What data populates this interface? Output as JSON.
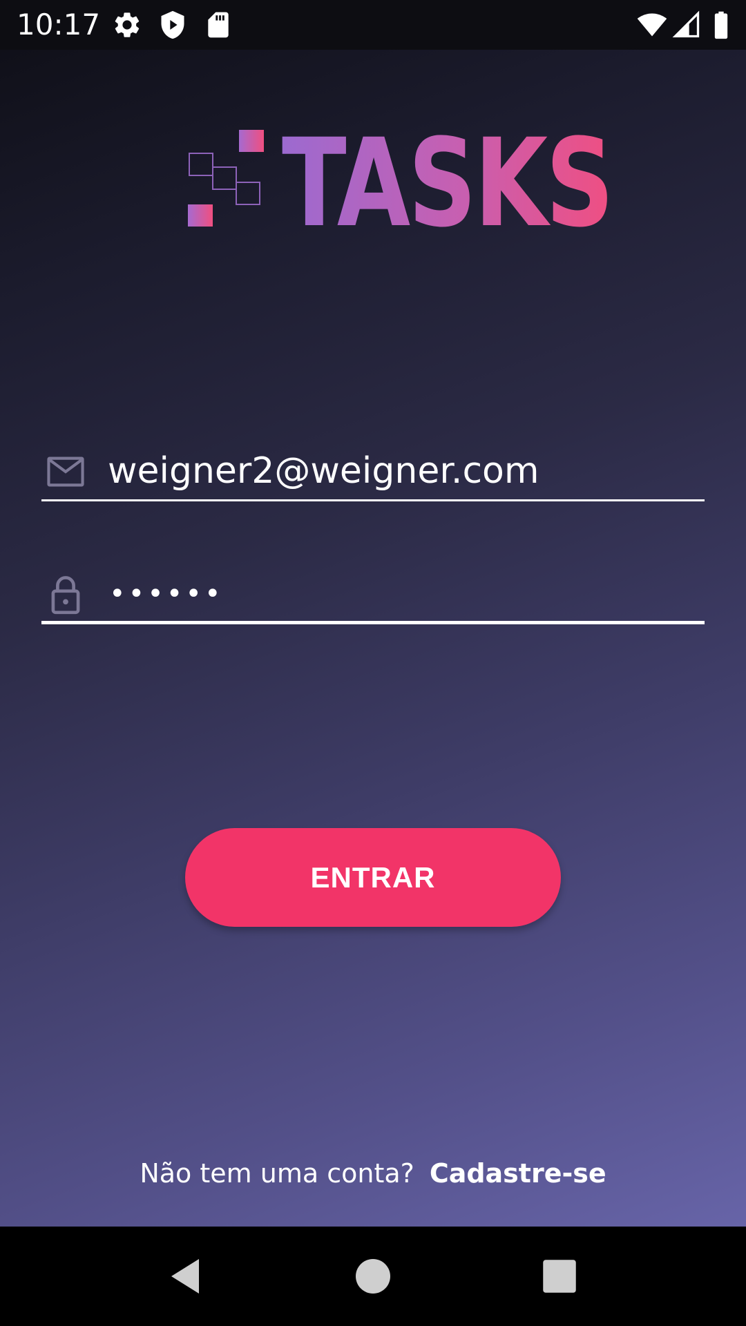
{
  "status_bar": {
    "time": "10:17",
    "icons": [
      "settings-icon",
      "shield-icon",
      "sd-card-icon",
      "wifi-icon",
      "signal-icon",
      "battery-icon"
    ]
  },
  "logo": {
    "text": "TASKS"
  },
  "login_form": {
    "email": {
      "icon": "mail-icon",
      "value": "weigner2@weigner.com"
    },
    "password": {
      "icon": "lock-icon",
      "masked_value": "••••••"
    },
    "submit_label": "ENTRAR"
  },
  "signup": {
    "prompt": "Não tem uma conta?",
    "link": "Cadastre-se"
  },
  "nav_bar": {
    "icons": [
      "back-icon",
      "home-icon",
      "recents-icon"
    ]
  },
  "colors": {
    "accent": "#f23468",
    "background_top": "#101019",
    "background_bottom": "#6764a8",
    "logo_gradient_start": "#9c6ad0",
    "logo_gradient_end": "#ef4f82"
  }
}
